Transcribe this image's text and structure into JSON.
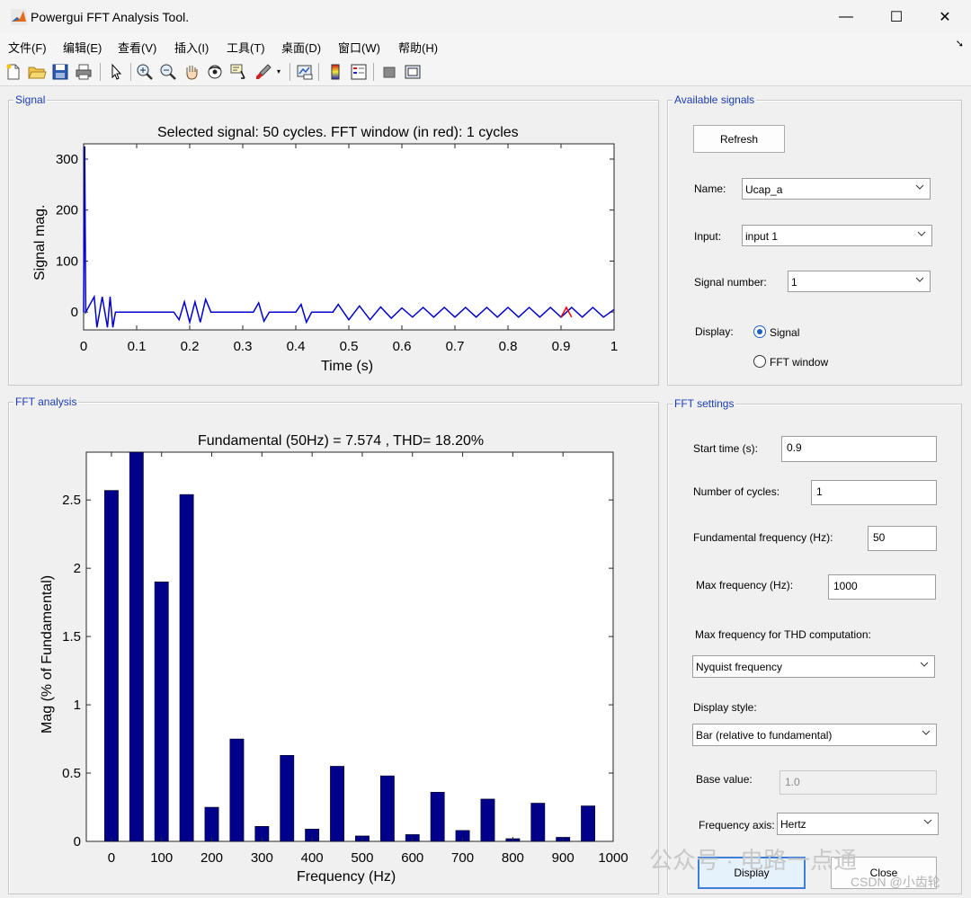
{
  "window": {
    "title": "Powergui FFT Analysis Tool.",
    "min_glyph": "—",
    "max_glyph": "☐",
    "close_glyph": "✕"
  },
  "menu": [
    "文件(F)",
    "编辑(E)",
    "查看(V)",
    "插入(I)",
    "工具(T)",
    "桌面(D)",
    "窗口(W)",
    "帮助(H)"
  ],
  "menu_dock_glyph": "➘",
  "toolbar_icons": [
    "new-file-icon",
    "open-folder-icon",
    "save-icon",
    "print-icon",
    "pointer-icon",
    "zoom-in-icon",
    "zoom-out-icon",
    "pan-hand-icon",
    "rotate-3d-icon",
    "data-cursor-icon",
    "brush-icon",
    "link-plot-icon",
    "colorbar-icon",
    "legend-icon",
    "hide-plot-tools-icon",
    "show-plot-tools-icon"
  ],
  "signal_panel": {
    "title": "Signal",
    "plot_title": "Selected signal: 50 cycles. FFT window (in red): 1 cycles",
    "xlabel": "Time (s)",
    "ylabel": "Signal mag."
  },
  "fft_panel": {
    "title": "FFT analysis",
    "plot_title": "Fundamental (50Hz) = 7.574 , THD= 18.20%",
    "xlabel": "Frequency (Hz)",
    "ylabel": "Mag (% of Fundamental)"
  },
  "available_signals": {
    "title": "Available signals",
    "refresh_label": "Refresh",
    "name_label": "Name:",
    "name_value": "Ucap_a",
    "input_label": "Input:",
    "input_value": "input 1",
    "signal_number_label": "Signal number:",
    "signal_number_value": "1",
    "display_label": "Display:",
    "display_options": [
      "Signal",
      "FFT window"
    ],
    "display_selected": "Signal"
  },
  "fft_settings": {
    "title": "FFT settings",
    "start_time_label": "Start time (s):",
    "start_time_value": "0.9",
    "cycles_label": "Number of cycles:",
    "cycles_value": "1",
    "fund_freq_label": "Fundamental frequency (Hz):",
    "fund_freq_value": "50",
    "max_freq_label": "Max frequency (Hz):",
    "max_freq_value": "1000",
    "thd_label": "Max frequency for THD computation:",
    "thd_value": "Nyquist frequency",
    "style_label": "Display style:",
    "style_value": "Bar (relative to fundamental)",
    "base_label": "Base value:",
    "base_value": "1.0",
    "axis_label": "Frequency axis:",
    "axis_value": "Hertz",
    "display_button": "Display",
    "close_button": "Close"
  },
  "watermark": {
    "text": "公众号 · 电路一点通",
    "csdn": "CSDN @小齿轮"
  },
  "colors": {
    "signal": "#0000cc",
    "fft_window": "#ff0000",
    "bar": "#00008b",
    "panel_title": "#1a3cb4",
    "accent": "#1f5fbf"
  },
  "chart_data": [
    {
      "type": "line",
      "title": "Selected signal: 50 cycles. FFT window (in red): 1 cycles",
      "xlabel": "Time (s)",
      "ylabel": "Signal mag.",
      "xlim": [
        0,
        1
      ],
      "ylim": [
        -35,
        330
      ],
      "xticks": [
        0,
        0.1,
        0.2,
        0.3,
        0.4,
        0.5,
        0.6,
        0.7,
        0.8,
        0.9,
        1
      ],
      "xtick_labels": [
        "0",
        "0.1",
        "0.2",
        "0.3",
        "0.4",
        "0.5",
        "0.6",
        "0.7",
        "0.8",
        "0.9",
        "1"
      ],
      "yticks": [
        0,
        100,
        200,
        300
      ],
      "ytick_labels": [
        "0",
        "100",
        "200",
        "300"
      ],
      "grid": false,
      "series": [
        {
          "values": [
            [
              0,
              0
            ],
            [
              0.002,
              325
            ],
            [
              0.004,
              0
            ],
            [
              0.02,
              30
            ],
            [
              0.025,
              -30
            ],
            [
              0.035,
              30
            ],
            [
              0.045,
              -30
            ],
            [
              0.05,
              30
            ],
            [
              0.055,
              -30
            ],
            [
              0.06,
              0
            ],
            [
              0.17,
              0
            ],
            [
              0.18,
              -15
            ],
            [
              0.19,
              20
            ],
            [
              0.2,
              -20
            ],
            [
              0.21,
              20
            ],
            [
              0.22,
              -20
            ],
            [
              0.23,
              25
            ],
            [
              0.24,
              0
            ],
            [
              0.32,
              0
            ],
            [
              0.33,
              18
            ],
            [
              0.34,
              -18
            ],
            [
              0.35,
              0
            ],
            [
              0.4,
              0
            ],
            [
              0.41,
              15
            ],
            [
              0.42,
              -20
            ],
            [
              0.43,
              0
            ],
            [
              0.47,
              0
            ],
            [
              0.48,
              15
            ],
            [
              0.5,
              -15
            ],
            [
              0.52,
              12
            ],
            [
              0.54,
              -15
            ],
            [
              0.56,
              10
            ],
            [
              0.58,
              -12
            ],
            [
              0.6,
              8
            ],
            [
              0.62,
              -10
            ],
            [
              0.64,
              9
            ],
            [
              0.66,
              -10
            ],
            [
              0.68,
              9
            ],
            [
              0.7,
              -10
            ],
            [
              0.72,
              9
            ],
            [
              0.74,
              -10
            ],
            [
              0.76,
              9
            ],
            [
              0.78,
              -10
            ],
            [
              0.8,
              9
            ],
            [
              0.82,
              -10
            ],
            [
              0.84,
              9
            ],
            [
              0.86,
              -10
            ],
            [
              0.88,
              9
            ],
            [
              0.9,
              -10
            ],
            [
              0.92,
              9
            ],
            [
              0.94,
              -10
            ],
            [
              0.96,
              9
            ],
            [
              0.98,
              -10
            ],
            [
              1,
              5
            ]
          ]
        },
        {
          "values": [
            [
              0.9,
              -10
            ],
            [
              0.91,
              9
            ],
            [
              0.92,
              -10
            ]
          ]
        }
      ]
    },
    {
      "type": "bar",
      "title": "Fundamental (50Hz) = 7.574 , THD= 18.20%",
      "xlabel": "Frequency (Hz)",
      "ylabel": "Mag (% of Fundamental)",
      "x": [
        0,
        50,
        100,
        150,
        200,
        250,
        300,
        350,
        400,
        450,
        500,
        550,
        600,
        650,
        700,
        750,
        800,
        850,
        900,
        950
      ],
      "values": [
        2.57,
        2.9,
        1.9,
        2.54,
        0.25,
        0.75,
        0.11,
        0.63,
        0.09,
        0.55,
        0.04,
        0.48,
        0.05,
        0.36,
        0.08,
        0.31,
        0.02,
        0.28,
        0.03,
        0.26
      ],
      "xlim": [
        -50,
        1000
      ],
      "ylim": [
        0,
        2.85
      ],
      "xticks": [
        0,
        100,
        200,
        300,
        400,
        500,
        600,
        700,
        800,
        900,
        1000
      ],
      "xtick_labels": [
        "0",
        "100",
        "200",
        "300",
        "400",
        "500",
        "600",
        "700",
        "800",
        "900",
        "1000"
      ],
      "yticks": [
        0,
        0.5,
        1,
        1.5,
        2,
        2.5
      ],
      "ytick_labels": [
        "0",
        "0.5",
        "1",
        "1.5",
        "2",
        "2.5"
      ],
      "grid": false
    }
  ]
}
